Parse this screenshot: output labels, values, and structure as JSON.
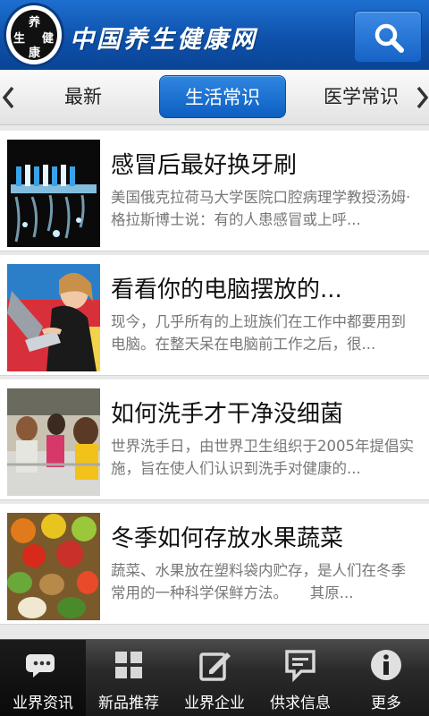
{
  "header": {
    "site_title": "中国养生健康网",
    "logo_chars": [
      "养",
      "生",
      "健",
      "康"
    ],
    "search_icon": "search-icon"
  },
  "tabs": [
    {
      "label": "最新",
      "active": false
    },
    {
      "label": "生活常识",
      "active": true
    },
    {
      "label": "医学常识",
      "active": false
    }
  ],
  "articles": [
    {
      "title": "感冒后最好换牙刷",
      "summary": "美国俄克拉荷马大学医院口腔病理学教授汤姆·格拉斯博士说：有的人患感冒或上呼..."
    },
    {
      "title": "看看你的电脑摆放的...",
      "summary": "现今，几乎所有的上班族们在工作中都要用到电脑。在整天呆在电脑前工作之后，很..."
    },
    {
      "title": "如何洗手才干净没细菌",
      "summary": "世界洗手日，由世界卫生组织于2005年提倡实施，旨在使人们认识到洗手对健康的..."
    },
    {
      "title": "冬季如何存放水果蔬菜",
      "summary": "蔬菜、水果放在塑料袋内贮存，是人们在冬季常用的一种科学保鲜方法。　　其原..."
    }
  ],
  "bottom_nav": [
    {
      "label": "业界资讯",
      "icon": "chat-bubble-icon",
      "active": true
    },
    {
      "label": "新品推荐",
      "icon": "grid-icon",
      "active": false
    },
    {
      "label": "业界企业",
      "icon": "edit-icon",
      "active": false
    },
    {
      "label": "供求信息",
      "icon": "message-icon",
      "active": false
    },
    {
      "label": "更多",
      "icon": "info-icon",
      "active": false
    }
  ],
  "colors": {
    "header_blue": "#0d4fa8",
    "tab_active": "#1663c7",
    "nav_bg": "#1a1a1a"
  }
}
